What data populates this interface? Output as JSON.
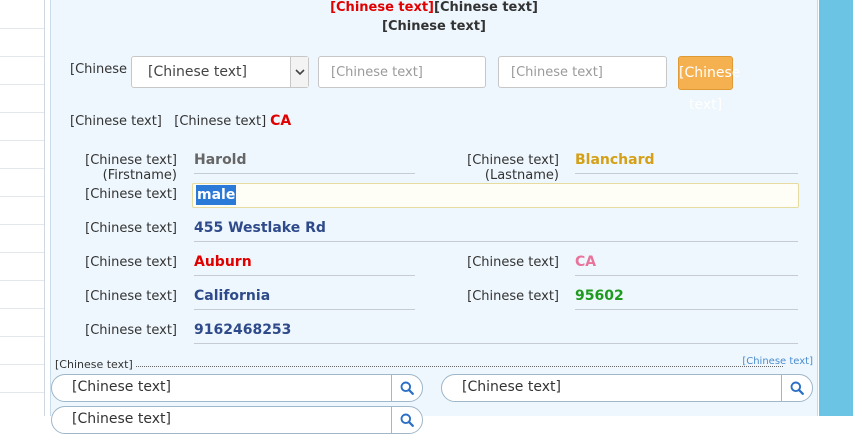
{
  "notice": {
    "line1_red": "[Chinese text]",
    "line1_dark": "[Chinese text]",
    "line2": "[Chinese text]"
  },
  "filter": {
    "label": "[Chinese text]",
    "select_value": "[Chinese text]",
    "city_placeholder": "[Chinese text]",
    "zip_placeholder": "[Chinese text]",
    "submit_label": "[Chinese text]"
  },
  "restriction": {
    "label": "[Chinese text]",
    "state_label": "[Chinese text]",
    "state_value": "CA"
  },
  "fields": {
    "firstname_label": "[Chinese text](Firstname)",
    "firstname_value": "Harold",
    "lastname_label": "[Chinese text](Lastname)",
    "lastname_value": "Blanchard",
    "gender_label": "[Chinese text]",
    "gender_value": "male",
    "street_label": "[Chinese text]",
    "street_value": "455 Westlake Rd",
    "city_label": "[Chinese text]",
    "city_value": "Auburn",
    "state_label": "[Chinese text]",
    "state_value": "CA",
    "state_full_label": "[Chinese text]",
    "state_full_value": "California",
    "zip_label": "[Chinese text]",
    "zip_value": "95602",
    "phone_label": "[Chinese text]",
    "phone_value": "9162468253"
  },
  "sponsor": {
    "label": "[Chinese text]",
    "ad_label": "[Chinese text]",
    "search_boxes": [
      "[Chinese text]",
      "[Chinese text]",
      "[Chinese text]"
    ]
  },
  "colors": {
    "panel_bg": "#eef7fd",
    "notice_red": "#e00000",
    "submit_bg": "#f5b14f",
    "right_rail": "#6cc4e4",
    "selection": "#2b7ad8"
  },
  "icons": {
    "select_arrow": "chevron-down-icon",
    "search": "search-icon"
  }
}
